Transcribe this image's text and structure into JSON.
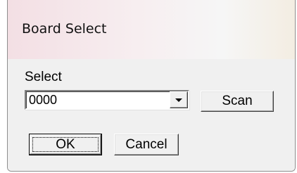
{
  "window": {
    "title": "Board Select"
  },
  "dialog": {
    "select_label": "Select",
    "board_combo": {
      "selected_value": "0000"
    },
    "scan_label": "Scan",
    "ok_label": "OK",
    "cancel_label": "Cancel"
  },
  "icons": {
    "dropdown": "chevron-down-icon"
  }
}
